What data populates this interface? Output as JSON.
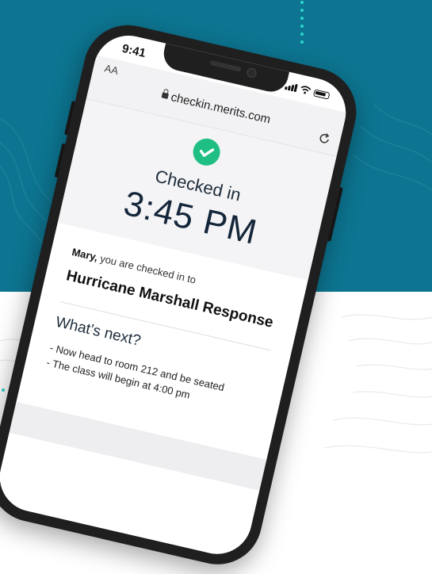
{
  "colors": {
    "background_top": "#0d7591",
    "accent_dots": "#2ed4cf",
    "success": "#1fbf84",
    "phone_frame": "#1f1f1f"
  },
  "status_bar": {
    "time": "9:41"
  },
  "browser": {
    "text_size_label": "AA",
    "url": "checkin.merits.com",
    "icons": [
      "lock-icon",
      "reload-icon"
    ]
  },
  "checkin": {
    "label": "Checked in",
    "time": "3:45 PM",
    "icon": "checkmark-circle-icon"
  },
  "details": {
    "user_name": "Mary,",
    "greeting_suffix": " you are checked in to",
    "event_name": "Hurricane Marshall Response",
    "next_title": "What’s next?",
    "next_steps": [
      "- Now head to room 212 and be seated",
      "- The class will begin at 4:00 pm"
    ]
  }
}
